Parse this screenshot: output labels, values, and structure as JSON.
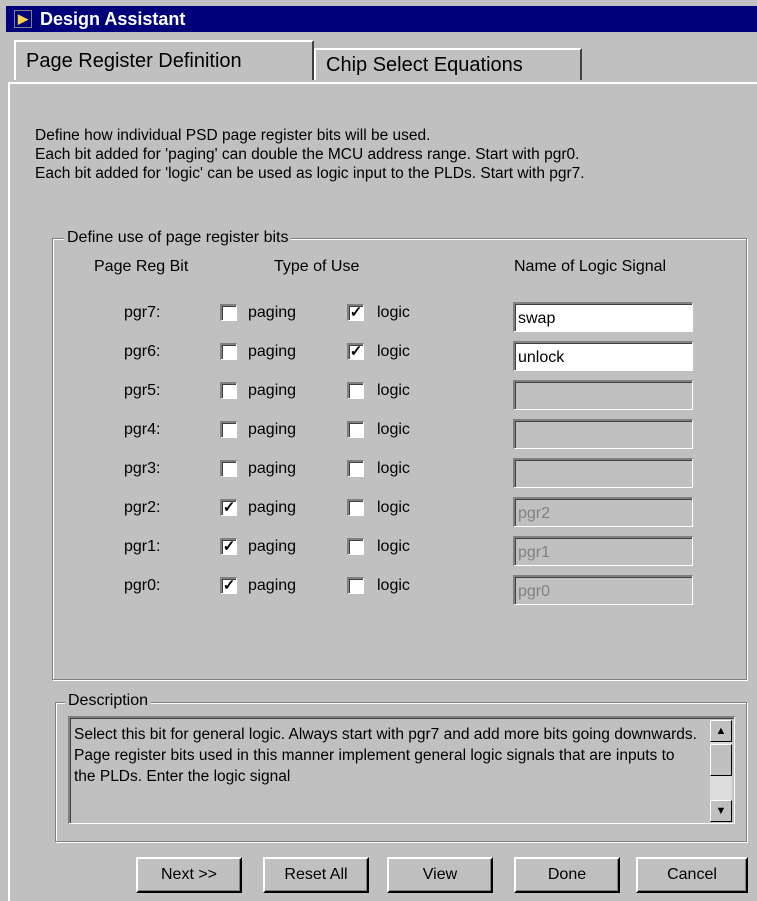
{
  "window": {
    "title": "Design Assistant",
    "icon": "app-icon"
  },
  "tabs": [
    {
      "label": "Page Register Definition",
      "active": true
    },
    {
      "label": "Chip Select Equations",
      "active": false
    }
  ],
  "intro": [
    "Define how individual PSD page register bits will be used.",
    "Each bit added for 'paging' can double the MCU address range. Start with pgr0.",
    "Each bit added for 'logic' can be used as logic input to the PLDs. Start with pgr7."
  ],
  "group": {
    "legend": "Define use of page register bits",
    "col_bit": "Page Reg Bit",
    "col_type": "Type of Use",
    "col_name": "Name of Logic Signal",
    "paging_label": "paging",
    "logic_label": "logic",
    "rows": [
      {
        "bit": "pgr7:",
        "paging": false,
        "logic": true,
        "name": "swap",
        "enabled": true
      },
      {
        "bit": "pgr6:",
        "paging": false,
        "logic": true,
        "name": "unlock",
        "enabled": true
      },
      {
        "bit": "pgr5:",
        "paging": false,
        "logic": false,
        "name": "",
        "enabled": false
      },
      {
        "bit": "pgr4:",
        "paging": false,
        "logic": false,
        "name": "",
        "enabled": false
      },
      {
        "bit": "pgr3:",
        "paging": false,
        "logic": false,
        "name": "",
        "enabled": false
      },
      {
        "bit": "pgr2:",
        "paging": true,
        "logic": false,
        "name": "pgr2",
        "enabled": false
      },
      {
        "bit": "pgr1:",
        "paging": true,
        "logic": false,
        "name": "pgr1",
        "enabled": false
      },
      {
        "bit": "pgr0:",
        "paging": true,
        "logic": false,
        "name": "pgr0",
        "enabled": false
      }
    ]
  },
  "description": {
    "legend": "Description",
    "text": "Select this bit for general logic.  Always start with pgr7 and add more bits going downwards.  Page register bits used in this manner implement general logic signals that are inputs to the PLDs.  Enter the logic signal"
  },
  "buttons": {
    "next": "Next >>",
    "reset": "Reset All",
    "view": "View",
    "done": "Done",
    "cancel": "Cancel"
  },
  "colors": {
    "titlebar": "#00007b",
    "face": "#c0c0c0"
  }
}
